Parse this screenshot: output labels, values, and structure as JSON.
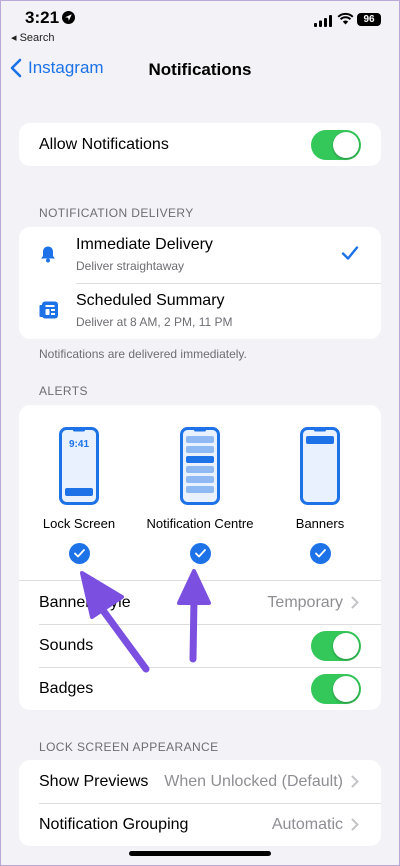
{
  "status_bar": {
    "time": "3:21",
    "back_app": "◂ Search",
    "battery": "96"
  },
  "nav": {
    "back_label": "Instagram",
    "title": "Notifications"
  },
  "allow": {
    "label": "Allow Notifications"
  },
  "delivery": {
    "header": "NOTIFICATION DELIVERY",
    "items": [
      {
        "title": "Immediate Delivery",
        "subtitle": "Deliver straightaway"
      },
      {
        "title": "Scheduled Summary",
        "subtitle": "Deliver at 8 AM, 2 PM, 11 PM"
      }
    ],
    "footer": "Notifications are delivered immediately."
  },
  "alerts": {
    "header": "ALERTS",
    "lock_time": "9:41",
    "options": [
      {
        "label": "Lock Screen"
      },
      {
        "label": "Notification Centre"
      },
      {
        "label": "Banners"
      }
    ],
    "banner_style": {
      "label": "Banner Style",
      "value": "Temporary"
    },
    "sounds": {
      "label": "Sounds"
    },
    "badges": {
      "label": "Badges"
    }
  },
  "lock_screen": {
    "header": "LOCK SCREEN APPEARANCE",
    "show_previews": {
      "label": "Show Previews",
      "value": "When Unlocked (Default)"
    },
    "grouping": {
      "label": "Notification Grouping",
      "value": "Automatic"
    }
  },
  "colors": {
    "accent": "#1d72e8",
    "toggle_on": "#34c759",
    "arrow": "#7b4fe0"
  }
}
